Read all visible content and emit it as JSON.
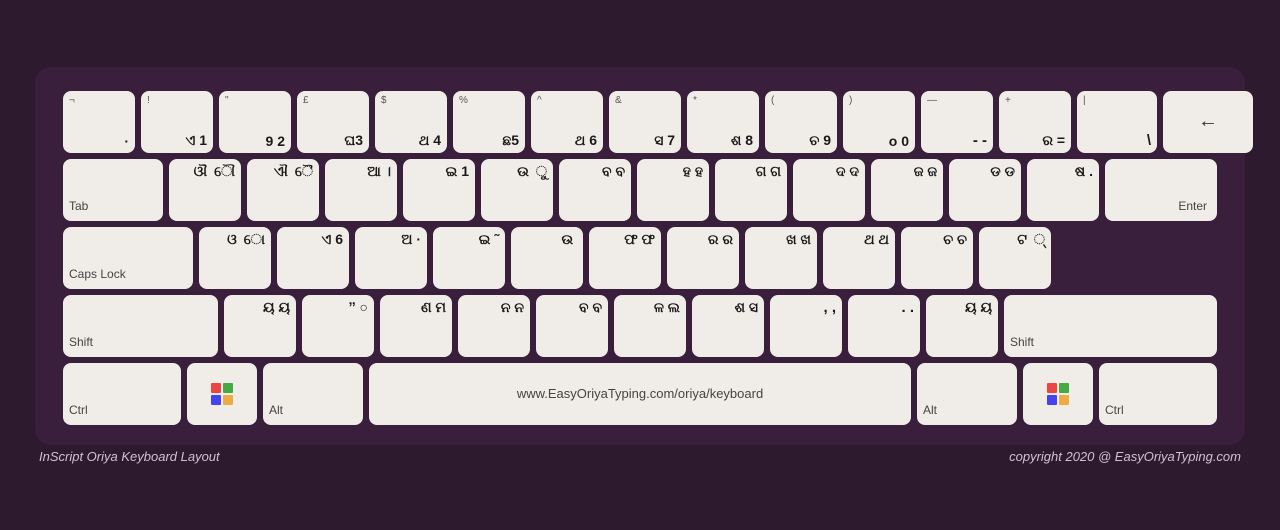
{
  "footer": {
    "left": "InScript Oriya Keyboard Layout",
    "right": "copyright 2020 @ EasyOriyaTyping.com"
  },
  "rows": [
    {
      "keys": [
        {
          "id": "backtick",
          "top_left": "¬",
          "top_right": "",
          "bottom": "·",
          "width": "std"
        },
        {
          "id": "1",
          "top_left": "!",
          "top_right": "",
          "bottom": "ଏ 1",
          "width": "std"
        },
        {
          "id": "2",
          "top_left": "\"",
          "top_right": "",
          "bottom": "9 2",
          "width": "std"
        },
        {
          "id": "3",
          "top_left": "£",
          "top_right": "",
          "bottom": "ଘ3",
          "width": "std"
        },
        {
          "id": "4",
          "top_left": "$",
          "top_right": "",
          "bottom": "ଥ 4",
          "width": "std"
        },
        {
          "id": "5",
          "top_left": "%",
          "top_right": "",
          "bottom": "ଛ5",
          "width": "std"
        },
        {
          "id": "6",
          "top_left": "^",
          "top_right": "",
          "bottom": "ଥ 6",
          "width": "std"
        },
        {
          "id": "7",
          "top_left": "&",
          "top_right": "",
          "bottom": "ସ 7",
          "width": "std"
        },
        {
          "id": "8",
          "top_left": "*",
          "top_right": "",
          "bottom": "ଶ 8",
          "width": "std"
        },
        {
          "id": "9",
          "top_left": "(",
          "top_right": "",
          "bottom": "ଚ 9",
          "width": "std"
        },
        {
          "id": "0",
          "top_left": ")",
          "top_right": "",
          "bottom": "o 0",
          "width": "std"
        },
        {
          "id": "minus",
          "top_left": "",
          "top_right": "",
          "bottom": "- -",
          "width": "std"
        },
        {
          "id": "equals",
          "top_left": "+",
          "top_right": "",
          "bottom": "ର =",
          "width": "std"
        },
        {
          "id": "backspace",
          "top_left": "",
          "top_right": "",
          "bottom": "←",
          "width": "backspace"
        }
      ]
    },
    {
      "keys": [
        {
          "id": "tab",
          "label": "Tab",
          "width": "tab"
        },
        {
          "id": "q",
          "top_left": "",
          "top_right": "",
          "bottom": "ଔ ୌ",
          "width": "std"
        },
        {
          "id": "w",
          "top_left": "",
          "top_right": "",
          "bottom": "ଐ ୈ",
          "width": "std"
        },
        {
          "id": "e",
          "top_left": "",
          "top_right": "",
          "bottom": "ଆ ।",
          "width": "std"
        },
        {
          "id": "r",
          "top_left": "",
          "top_right": "",
          "bottom": "ଇ 1",
          "width": "std"
        },
        {
          "id": "t",
          "top_left": "",
          "top_right": "",
          "bottom": "ଉ ୁ",
          "width": "std"
        },
        {
          "id": "y",
          "top_left": "",
          "top_right": "",
          "bottom": "ବ ବ",
          "width": "std"
        },
        {
          "id": "u",
          "top_left": "",
          "top_right": "",
          "bottom": "ହ ହ",
          "width": "std"
        },
        {
          "id": "i",
          "top_left": "",
          "top_right": "",
          "bottom": "ଗ ଗ",
          "width": "std"
        },
        {
          "id": "o",
          "top_left": "",
          "top_right": "",
          "bottom": "ଦ ଦ",
          "width": "std"
        },
        {
          "id": "p",
          "top_left": "",
          "top_right": "",
          "bottom": "ଜ ଜ",
          "width": "std"
        },
        {
          "id": "lbracket",
          "top_left": "",
          "top_right": "",
          "bottom": "ଡ ଡ",
          "width": "std"
        },
        {
          "id": "rbracket",
          "top_left": "",
          "top_right": "",
          "bottom": ". .",
          "width": "std"
        },
        {
          "id": "enter",
          "label": "Enter",
          "width": "enter",
          "rowspan": true
        }
      ]
    },
    {
      "keys": [
        {
          "id": "caps",
          "label": "Caps Lock",
          "width": "caps"
        },
        {
          "id": "a",
          "top_left": "",
          "top_right": "",
          "bottom": "ଓ ୋ",
          "width": "std"
        },
        {
          "id": "s",
          "top_left": "",
          "top_right": "",
          "bottom": "ଏ 6",
          "width": "std"
        },
        {
          "id": "d",
          "top_left": "",
          "top_right": "",
          "bottom": "ଅ ·",
          "width": "std"
        },
        {
          "id": "f",
          "top_left": "",
          "top_right": "",
          "bottom": "ଇ ˜",
          "width": "std"
        },
        {
          "id": "g",
          "top_left": "",
          "top_right": "",
          "bottom": "ଉ ‌",
          "width": "std"
        },
        {
          "id": "h",
          "top_left": "",
          "top_right": "",
          "bottom": "ଫ ଫ",
          "width": "std"
        },
        {
          "id": "j",
          "top_left": "",
          "top_right": "",
          "bottom": "ର ର",
          "width": "std"
        },
        {
          "id": "k",
          "top_left": "",
          "top_right": "",
          "bottom": "ଖ ଖ",
          "width": "std"
        },
        {
          "id": "l",
          "top_left": "",
          "top_right": "",
          "bottom": "ଥ ଥ",
          "width": "std"
        },
        {
          "id": "semi",
          "top_left": "",
          "top_right": "",
          "bottom": "ଚ ଚ",
          "width": "std"
        },
        {
          "id": "quote",
          "top_left": "",
          "top_right": "",
          "bottom": "ଟ ୍",
          "width": "std"
        }
      ]
    },
    {
      "keys": [
        {
          "id": "shift-l",
          "label": "Shift",
          "width": "shift-l"
        },
        {
          "id": "z",
          "top_left": "",
          "top_right": "",
          "bottom": "ୟ ୟ",
          "width": "std"
        },
        {
          "id": "x",
          "top_left": "",
          "top_right": "",
          "bottom": "ˮ ○",
          "width": "std"
        },
        {
          "id": "c",
          "top_left": "",
          "top_right": "",
          "bottom": "ଣ ମ",
          "width": "std"
        },
        {
          "id": "v",
          "top_left": "",
          "top_right": "",
          "bottom": "ନ ନ",
          "width": "std"
        },
        {
          "id": "b",
          "top_left": "",
          "top_right": "",
          "bottom": "ବ ବ",
          "width": "std"
        },
        {
          "id": "n",
          "top_left": "",
          "top_right": "",
          "bottom": "ଳ ଲ",
          "width": "std"
        },
        {
          "id": "m",
          "top_left": "",
          "top_right": "",
          "bottom": "ଶ ସ",
          "width": "std"
        },
        {
          "id": "comma",
          "top_left": "",
          "top_right": "",
          "bottom": ", ,",
          "width": "std"
        },
        {
          "id": "period",
          "top_left": "",
          "top_right": "",
          "bottom": ". .",
          "width": "std"
        },
        {
          "id": "slash",
          "top_left": "",
          "top_right": "",
          "bottom": "ୟ ୟ",
          "width": "std"
        },
        {
          "id": "shift-r",
          "label": "Shift",
          "width": "shift-r"
        }
      ]
    },
    {
      "keys": [
        {
          "id": "ctrl-l",
          "label": "Ctrl",
          "width": "ctrl"
        },
        {
          "id": "win-l",
          "label": "win",
          "width": "win"
        },
        {
          "id": "alt-l",
          "label": "Alt",
          "width": "alt"
        },
        {
          "id": "space",
          "label": "www.EasyOriyaTyping.com/oriya/keyboard",
          "width": "space"
        },
        {
          "id": "alt-r",
          "label": "Alt",
          "width": "alt"
        },
        {
          "id": "win-r",
          "label": "win",
          "width": "win"
        },
        {
          "id": "ctrl-r",
          "label": "Ctrl",
          "width": "ctrl"
        }
      ]
    }
  ]
}
